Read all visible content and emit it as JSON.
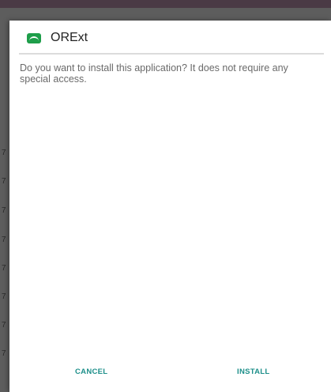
{
  "dialog": {
    "app_name": "ORExt",
    "app_icon": "orext-app-icon",
    "message": "Do you want to install this application? It does not require any special access.",
    "buttons": {
      "cancel": "CANCEL",
      "install": "INSTALL"
    }
  },
  "colors": {
    "accent": "#1d8f8a",
    "icon_green": "#1e9e4a",
    "scrim": "#5d5d5d",
    "statusbar": "#4a3a45"
  }
}
